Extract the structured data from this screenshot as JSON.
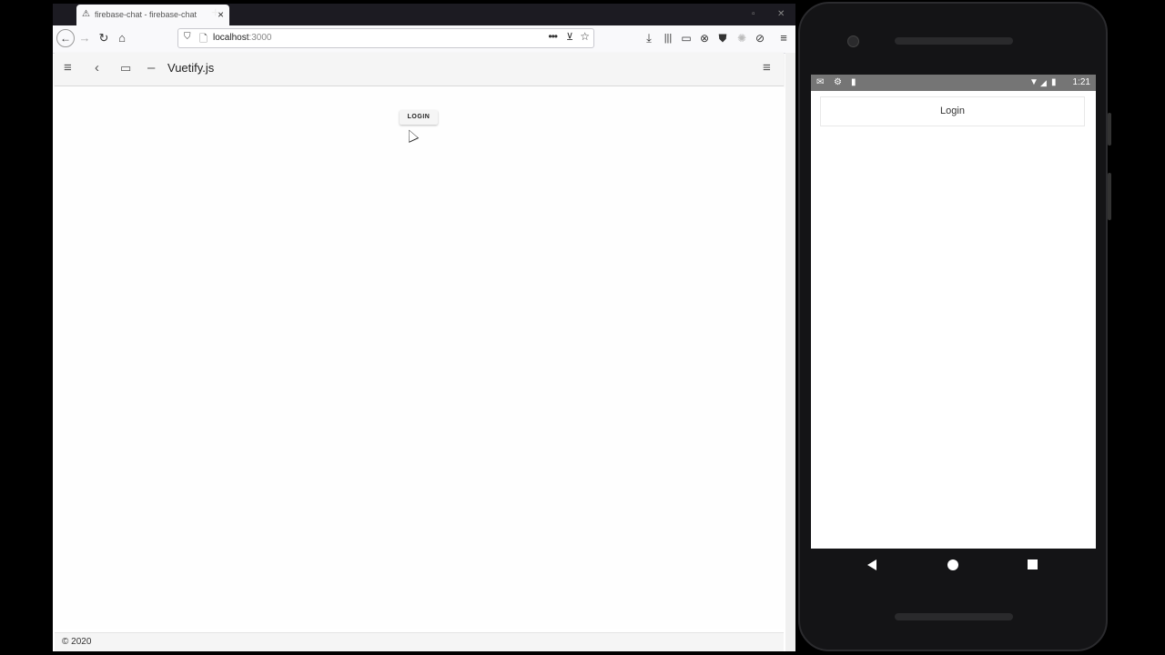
{
  "browser": {
    "tab": {
      "title": "firebase-chat - firebase-chat",
      "warn_icon": "warning-icon",
      "close": "×"
    },
    "new_tab": "+",
    "url": {
      "host": "localhost",
      "port": ":3000"
    },
    "toolbar": {
      "more": "•••"
    }
  },
  "app": {
    "title": "Vuetify.js",
    "login_label": "LOGIN",
    "footer": "© 2020"
  },
  "phone": {
    "status_time": "1:21",
    "login_label": "Login"
  }
}
